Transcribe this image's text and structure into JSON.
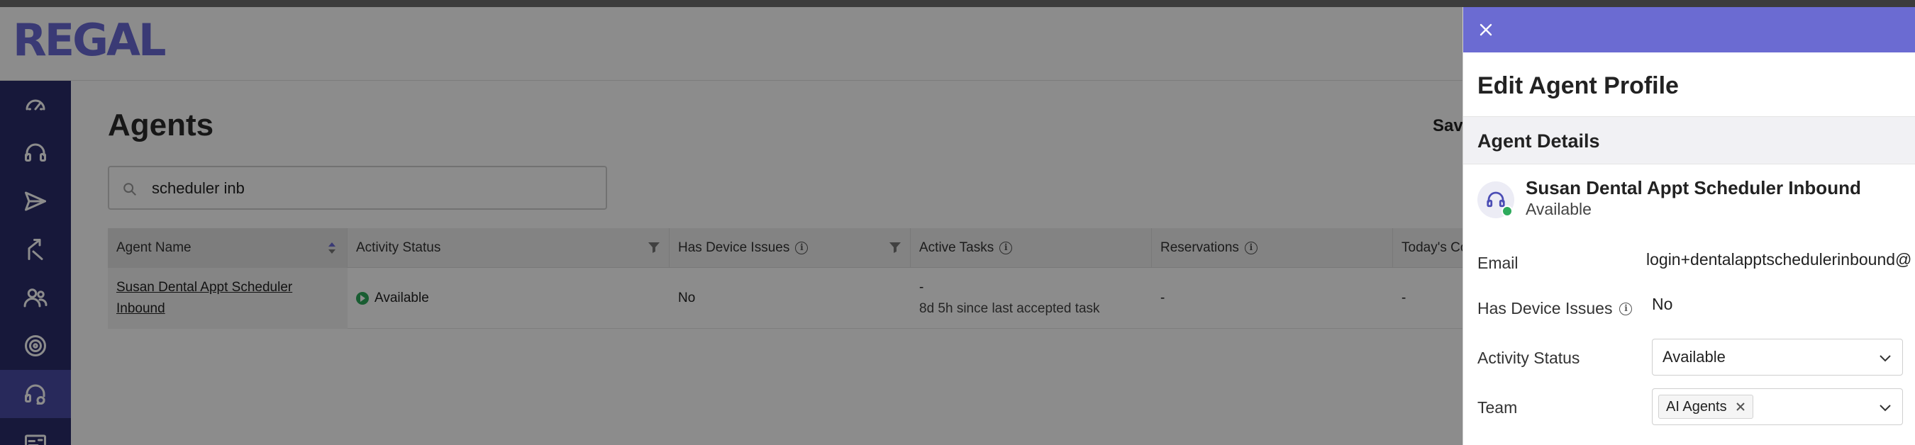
{
  "app": {
    "logo": "REGAL"
  },
  "sidebar": {
    "items": [
      {
        "icon": "speedometer-icon",
        "active": false
      },
      {
        "icon": "headset-icon",
        "active": false
      },
      {
        "icon": "send-icon",
        "active": false
      },
      {
        "icon": "routing-icon",
        "active": false
      },
      {
        "icon": "users-icon",
        "active": false
      },
      {
        "icon": "target-icon",
        "active": false
      },
      {
        "icon": "agent-headset-icon",
        "active": true
      },
      {
        "icon": "id-card-icon",
        "active": false
      }
    ]
  },
  "main": {
    "title": "Agents",
    "saved_label": "Save",
    "search": {
      "value": "scheduler inb"
    },
    "table": {
      "columns": [
        {
          "label": "Agent Name"
        },
        {
          "label": "Activity Status"
        },
        {
          "label": "Has Device Issues"
        },
        {
          "label": "Active Tasks"
        },
        {
          "label": "Reservations"
        },
        {
          "label": "Today's Co"
        }
      ],
      "rows": [
        {
          "agent_name": "Susan Dental Appt Scheduler Inbound",
          "activity_status": "Available",
          "has_device_issues": "No",
          "active_tasks": "-",
          "active_tasks_sub": "8d 5h since last accepted task",
          "reservations": "-",
          "todays": "-"
        }
      ]
    }
  },
  "drawer": {
    "title": "Edit Agent Profile",
    "section": "Agent Details",
    "agent": {
      "name": "Susan Dental Appt Scheduler Inbound",
      "status": "Available"
    },
    "fields": {
      "email_label": "Email",
      "email_value": "login+dentalapptschedulerinbound@",
      "device_label": "Has Device Issues",
      "device_value": "No",
      "activity_label": "Activity Status",
      "activity_value": "Available",
      "team_label": "Team",
      "team_tag": "AI Agents"
    }
  },
  "colors": {
    "brand": "#6b6bd6",
    "sidebar": "#2b2d6b",
    "sidebar_active": "#4a4ca6",
    "drawer_bar": "#6b6bd2",
    "available": "#2eaa5c"
  }
}
